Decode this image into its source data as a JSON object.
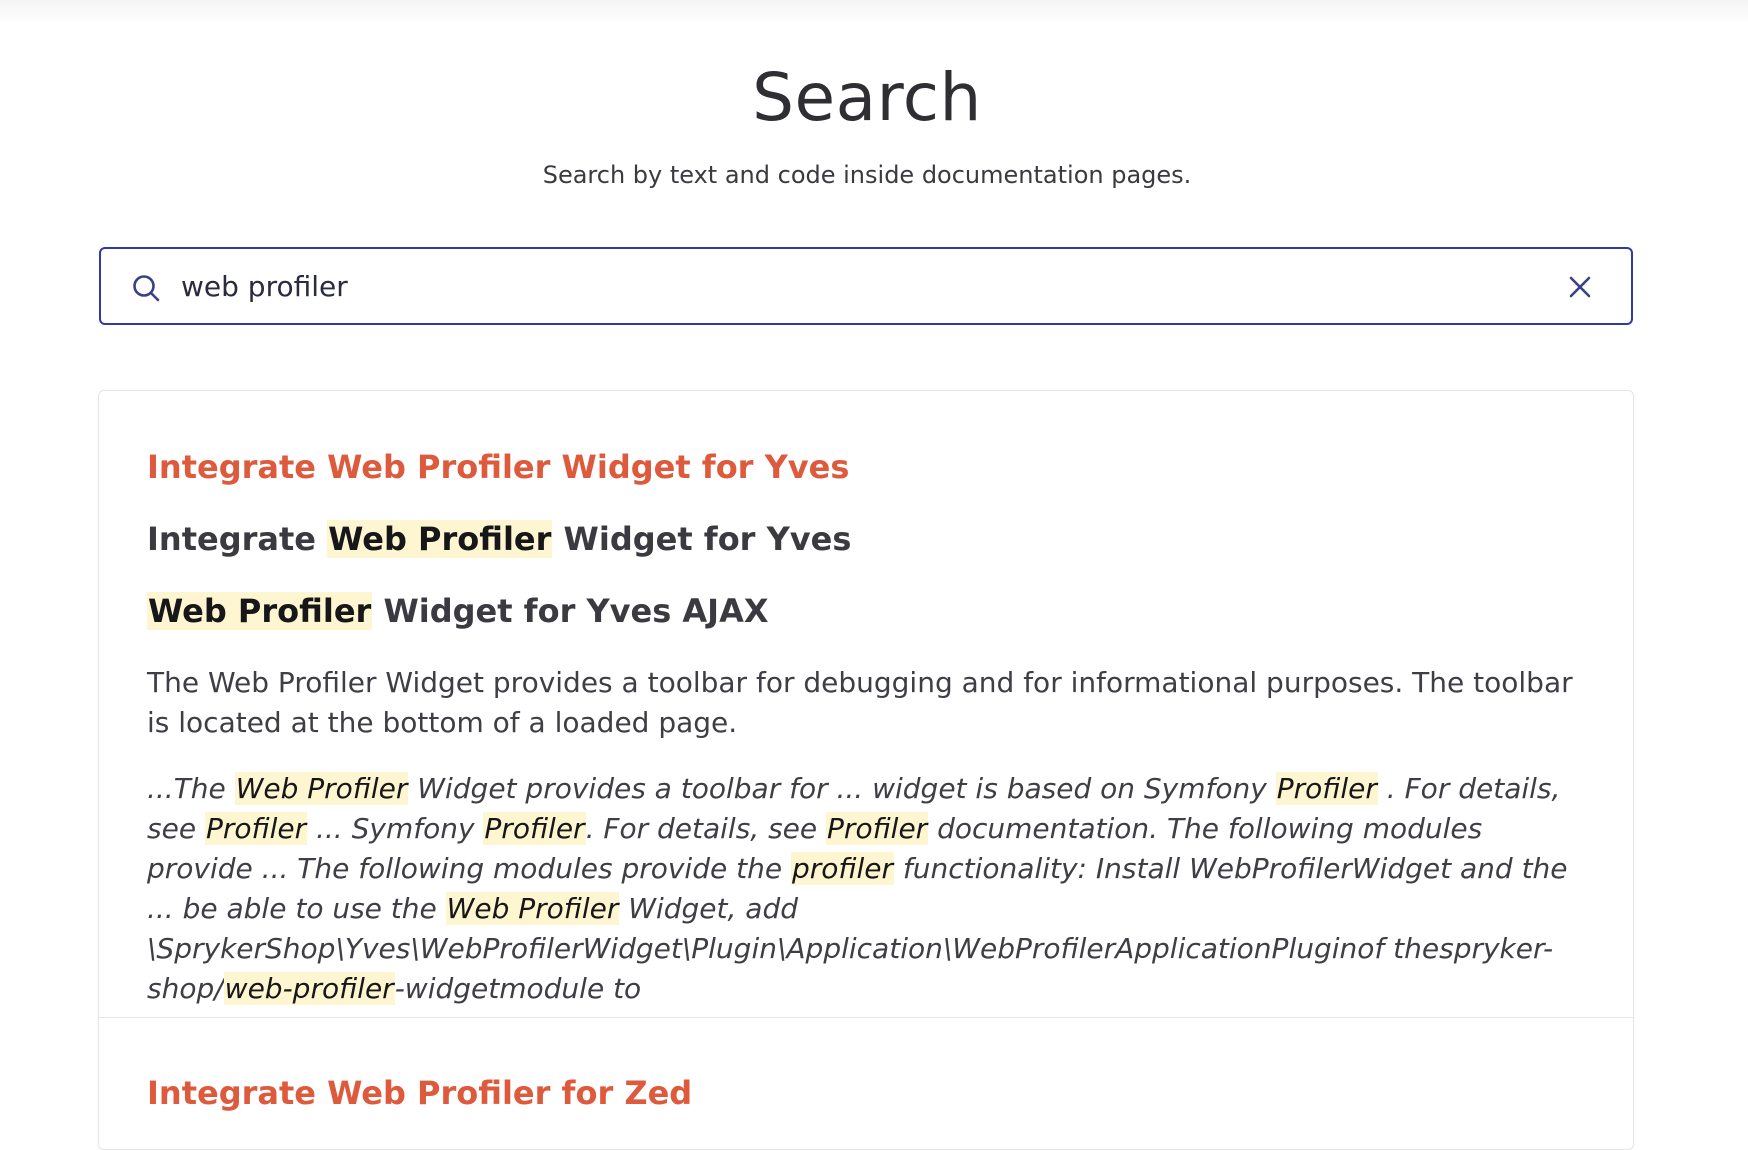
{
  "page": {
    "title": "Search",
    "subtitle": "Search by text and code inside documentation pages."
  },
  "search": {
    "value": "web profiler",
    "search_icon": "search-icon",
    "clear_icon": "close-icon"
  },
  "colors": {
    "accent_border": "#2f3aa6",
    "result_title": "#dd5a3c",
    "highlight": "#fdf6d0"
  },
  "results": [
    {
      "title": "Integrate Web Profiler Widget for Yves",
      "headings": [
        {
          "pre": "Integrate ",
          "hl": "Web Profiler",
          "post": " Widget for Yves"
        },
        {
          "pre": "",
          "hl": "Web Profiler",
          "post": " Widget for Yves AJAX"
        }
      ],
      "description": "The Web Profiler Widget provides a toolbar for debugging and for informational purposes. The toolbar is located at the bottom of a loaded page.",
      "snippet": {
        "s0": "...The ",
        "h0": "Web Profiler",
        "s1": " Widget provides a toolbar for ... widget is based on Symfony ",
        "h1": "Profiler",
        "s2": " . For details, see ",
        "h2": "Profiler",
        "s3": " ... Symfony ",
        "h3": "Profiler",
        "s4": ". For details, see ",
        "h4": "Profiler",
        "s5": " documentation. The following modules provide ... The following modules provide the ",
        "h5": "profiler",
        "s6": " functionality: Install WebProfilerWidget and the ... be able to use the ",
        "h6": "Web Profiler",
        "s7": " Widget, add \\SprykerShop\\Yves\\WebProfilerWidget\\Plugin\\Application\\WebProfilerApplicationPluginof thespryker-shop/",
        "h7": "web-profiler",
        "s8": "-widgetmodule to"
      }
    },
    {
      "title": "Integrate Web Profiler for Zed"
    }
  ]
}
